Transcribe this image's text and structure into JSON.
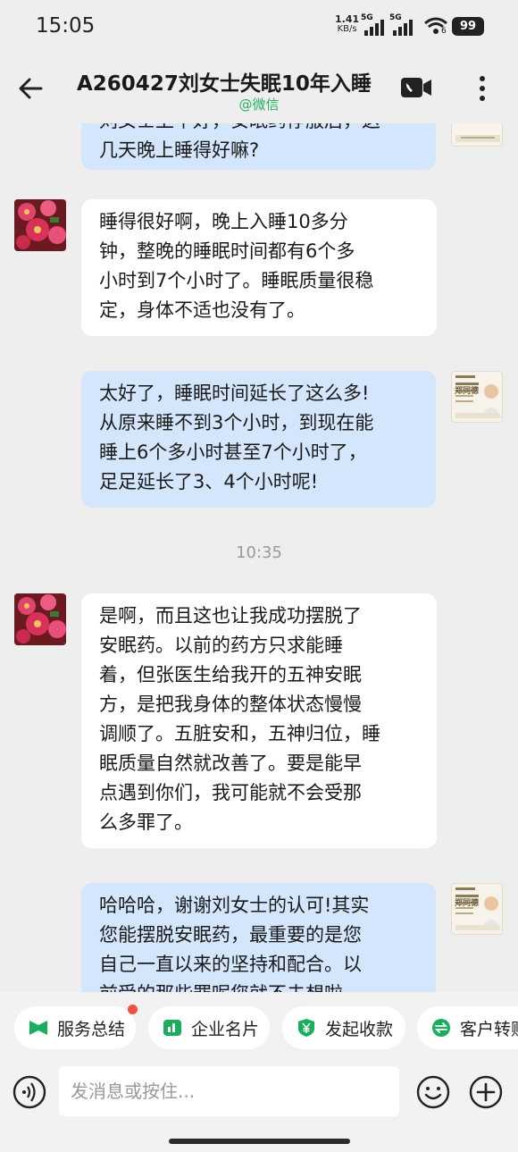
{
  "status_bar": {
    "time": "15:05",
    "net_speed": "1.41",
    "net_unit": "KB/s",
    "sim1": "5G",
    "sim2": "5G",
    "wifi_sub": "6",
    "battery": "99"
  },
  "header": {
    "title": "A260427刘女士失眠10年入睡",
    "subtitle": "@微信",
    "back_icon": "back-arrow-icon",
    "call_icon": "phone-video-call-icon",
    "more_icon": "more-vertical-icon"
  },
  "messages": [
    {
      "side": "out",
      "lines": [
        "刘女士上午好，安眠药停服后，这",
        "几天晚上睡得好嘛?"
      ]
    },
    {
      "side": "in",
      "lines": [
        "睡得很好啊，晚上入睡10多分",
        "钟，整晚的睡眠时间都有6个多",
        "小时到7个小时了。睡眠质量很稳",
        "定，身体不适也没有了。"
      ]
    },
    {
      "side": "out",
      "lines": [
        "太好了，睡眠时间延长了这么多!",
        "从原来睡不到3个小时，到现在能",
        "睡上6个多小时甚至7个小时了，",
        "足足延长了3、4个小时呢!"
      ]
    },
    {
      "timestamp": "10:35"
    },
    {
      "side": "in",
      "lines": [
        "是啊，而且这也让我成功摆脱了",
        "安眠药。以前的药方只求能睡",
        "着，但张医生给我开的五神安眠",
        "方，是把我身体的整体状态慢慢",
        "调顺了。五脏安和，五神归位，睡",
        "眠质量自然就改善了。要是能早",
        "点遇到你们，我可能就不会受那",
        "么多罪了。"
      ]
    },
    {
      "side": "out",
      "lines": [
        "哈哈哈，谢谢刘女士的认可!其实",
        "您能摆脱安眠药，最重要的是您",
        "自己一直以来的坚持和配合。以",
        "前受的那些罪呢您就不去想啦"
      ]
    }
  ],
  "avatar_card_name": "郑同德",
  "quick_actions": [
    {
      "label": "服务总结",
      "icon": "service-summary-icon",
      "color": "#1aad5e",
      "badge": true
    },
    {
      "label": "企业名片",
      "icon": "business-card-icon",
      "color": "#1aad5e",
      "badge": false
    },
    {
      "label": "发起收款",
      "icon": "payment-yuan-icon",
      "color": "#1aad5e",
      "badge": false
    },
    {
      "label": "客户转账",
      "icon": "transfer-icon",
      "color": "#1aad5e",
      "badge": false
    }
  ],
  "input_bar": {
    "placeholder": "发消息或按住...",
    "voice_icon": "voice-input-icon",
    "emoji_icon": "emoji-icon",
    "plus_icon": "add-plus-icon"
  },
  "colors": {
    "incoming_bubble": "#ffffff",
    "outgoing_bubble": "#d3e6fb",
    "accent_green": "#1aad5e",
    "badge_red": "#f25042"
  }
}
